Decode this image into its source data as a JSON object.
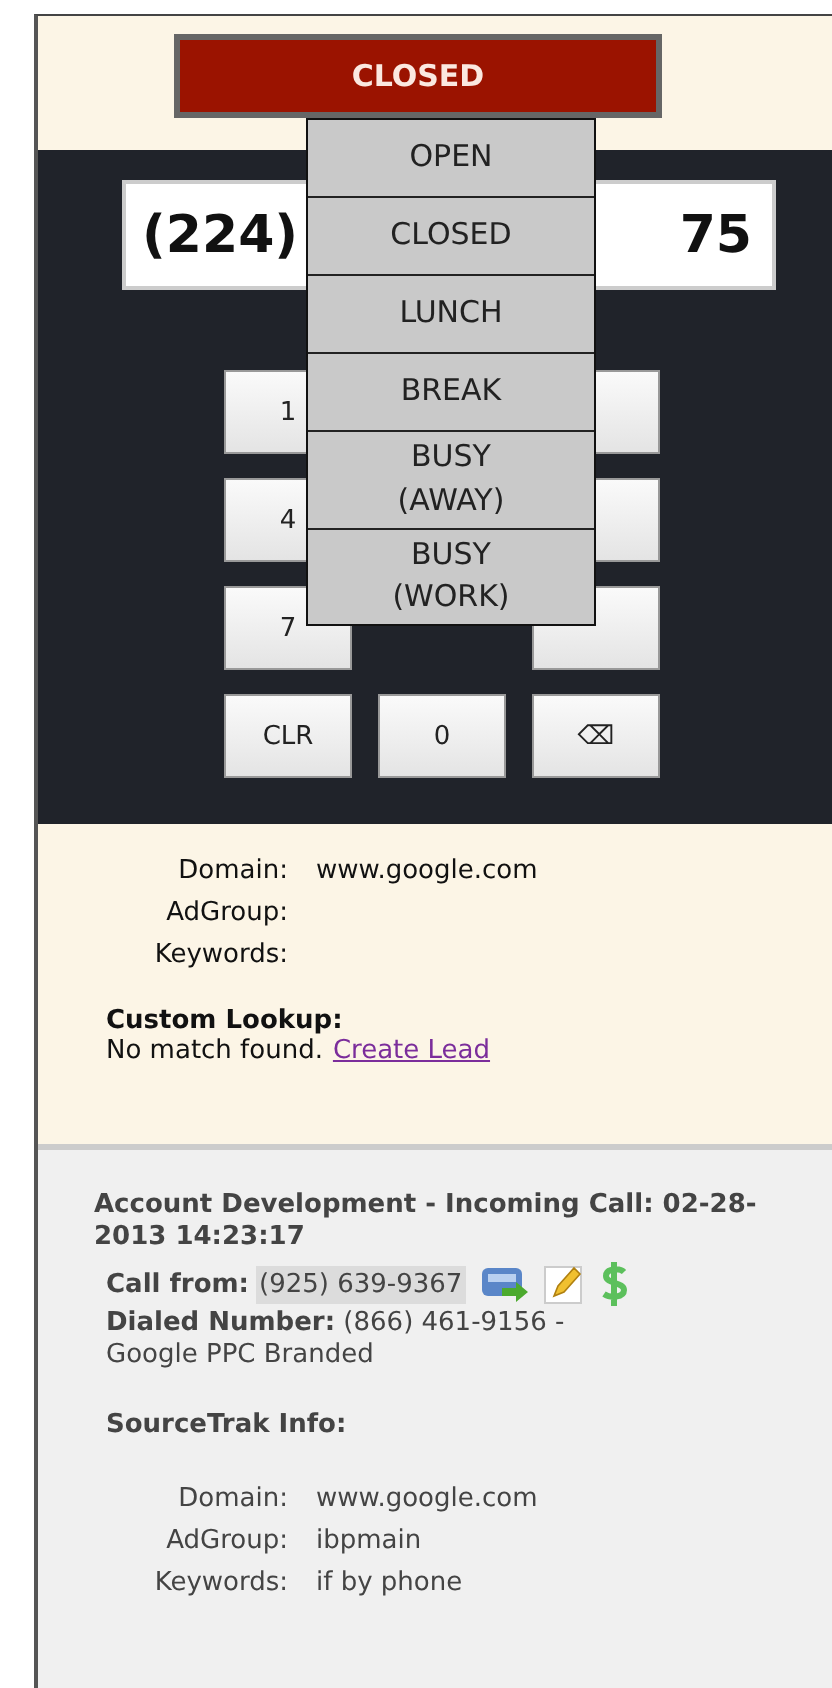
{
  "status_button": {
    "label": "CLOSED"
  },
  "phone_field": {
    "value_start": "(224)",
    "value_end": "75"
  },
  "status_menu": {
    "items": [
      {
        "label": "OPEN"
      },
      {
        "label": "CLOSED"
      },
      {
        "label": "LUNCH"
      },
      {
        "label": "BREAK"
      },
      {
        "label": "BUSY (AWAY)"
      },
      {
        "label": "BUSY (WORK)"
      }
    ]
  },
  "keypad": {
    "keys": [
      {
        "kind": "key",
        "label": "1"
      },
      {
        "kind": "hidden"
      },
      {
        "kind": "covered"
      },
      {
        "kind": "key",
        "label": "4"
      },
      {
        "kind": "hidden"
      },
      {
        "kind": "covered"
      },
      {
        "kind": "key",
        "label": "7"
      },
      {
        "kind": "hidden"
      },
      {
        "kind": "covered"
      },
      {
        "kind": "key",
        "label": "CLR"
      },
      {
        "kind": "key",
        "label": "0"
      },
      {
        "kind": "key",
        "label": "⌫"
      }
    ]
  },
  "lookup": {
    "fields": [
      {
        "label": "Domain:",
        "value": "www.google.com"
      },
      {
        "label": "AdGroup:"
      },
      {
        "label": "Keywords:"
      }
    ],
    "custom_lookup_title": "Custom Lookup:",
    "message": "No match found.",
    "link": "Create Lead"
  },
  "call": {
    "heading": "Account Development - Incoming Call: 02-28-2013 14:23:17",
    "call_from_label": "Call from:",
    "call_from_number": "(925) 639-9367",
    "dialed_label": "Dialed Number:",
    "dialed_value": "(866) 461-9156 - Google PPC Branded",
    "sourcetrak_title": "SourceTrak Info:",
    "fields": [
      {
        "label": "Domain:",
        "value": "www.google.com"
      },
      {
        "label": "AdGroup:",
        "value": "ibpmain"
      },
      {
        "label": "Keywords:",
        "value": "if by phone"
      }
    ]
  }
}
